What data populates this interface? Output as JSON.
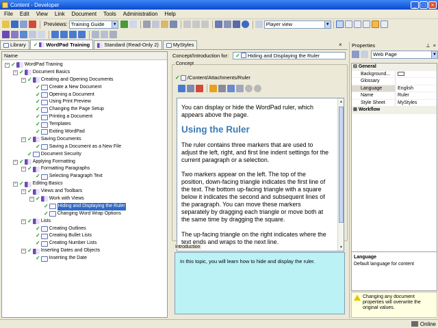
{
  "window": {
    "title": "Content - Developer"
  },
  "menu": [
    "File",
    "Edit",
    "View",
    "Link",
    "Document",
    "Tools",
    "Administration",
    "Help"
  ],
  "toolbar": {
    "previews_label": "Previews:",
    "previews_value": "Training Guide",
    "player_value": "Player view"
  },
  "tabs": [
    {
      "label": "Library",
      "checked": false
    },
    {
      "label": "WordPad Training",
      "checked": true
    },
    {
      "label": "Standard (Read-Only 2)",
      "checked": false
    },
    {
      "label": "MyStyles",
      "checked": false
    }
  ],
  "tree": {
    "header": "Name",
    "items": [
      {
        "label": "WordPad Training",
        "depth": 0,
        "icon": "book",
        "toggle": "-"
      },
      {
        "label": "Document Basics",
        "depth": 1,
        "icon": "book",
        "toggle": "-"
      },
      {
        "label": "Creating and Opening Documents",
        "depth": 2,
        "icon": "book",
        "toggle": "-"
      },
      {
        "label": "Create a New Document",
        "depth": 3,
        "icon": "page",
        "toggle": ""
      },
      {
        "label": "Opening a Document",
        "depth": 3,
        "icon": "page",
        "toggle": ""
      },
      {
        "label": "Using Print Preview",
        "depth": 3,
        "icon": "page",
        "toggle": ""
      },
      {
        "label": "Changing the Page Setup",
        "depth": 3,
        "icon": "page",
        "toggle": ""
      },
      {
        "label": "Printing a Document",
        "depth": 3,
        "icon": "page",
        "toggle": ""
      },
      {
        "label": "Templates",
        "depth": 3,
        "icon": "page",
        "toggle": ""
      },
      {
        "label": "Exiting WordPad",
        "depth": 3,
        "icon": "page",
        "toggle": ""
      },
      {
        "label": "Saving Documents",
        "depth": 2,
        "icon": "book",
        "toggle": "-"
      },
      {
        "label": "Saving a Document as a New File",
        "depth": 3,
        "icon": "page",
        "toggle": ""
      },
      {
        "label": "Document Security",
        "depth": 2,
        "icon": "page",
        "toggle": ""
      },
      {
        "label": "Applying Formatting",
        "depth": 1,
        "icon": "book",
        "toggle": "-"
      },
      {
        "label": "Formatting Paragraphs",
        "depth": 2,
        "icon": "book",
        "toggle": "-"
      },
      {
        "label": "Selecting Paragraph Text",
        "depth": 3,
        "icon": "page",
        "toggle": ""
      },
      {
        "label": "Editing Basics",
        "depth": 1,
        "icon": "book",
        "toggle": "-"
      },
      {
        "label": "Views and Toolbars",
        "depth": 2,
        "icon": "book",
        "toggle": "-"
      },
      {
        "label": "Work with Views",
        "depth": 3,
        "icon": "book",
        "toggle": "-"
      },
      {
        "label": "Hiding and Displaying the Ruler",
        "depth": 4,
        "icon": "page",
        "toggle": "",
        "selected": true
      },
      {
        "label": "Changing Word Wrap Options",
        "depth": 4,
        "icon": "page",
        "toggle": ""
      },
      {
        "label": "Lists",
        "depth": 2,
        "icon": "book",
        "toggle": "-"
      },
      {
        "label": "Creating Outlines",
        "depth": 3,
        "icon": "page",
        "toggle": ""
      },
      {
        "label": "Creating Bullet Lists",
        "depth": 3,
        "icon": "page",
        "toggle": ""
      },
      {
        "label": "Creating Number Lists",
        "depth": 3,
        "icon": "page",
        "toggle": ""
      },
      {
        "label": "Inserting Dates and Objects",
        "depth": 2,
        "icon": "book",
        "toggle": "-"
      },
      {
        "label": "Inserting the Date",
        "depth": 3,
        "icon": "page",
        "toggle": ""
      }
    ]
  },
  "concept": {
    "header_label": "Concept/Introduction for:",
    "header_value": "Hiding and Displaying the Ruler",
    "group_label": "Concept",
    "path": "/Content/Attachments/Ruler",
    "para1": "You can display or hide the WordPad ruler, which appears above the page.",
    "heading": "Using the Ruler",
    "para2": "The ruler contains three markers that are used to adjust the left, right, and first line indent settings for the current paragraph or a selection.",
    "para3": "Two markers appear on the left. The top of the position, down-facing triangle indicates the first line of the text. The bottom up-facing triangle with a square below it indicates the second and subsequent lines of the paragraph. You can move these markers separately by dragging each triangle or move both at the same time by dragging the square.",
    "para4": "The up-facing triangle on the right indicates where the text ends and wraps to the next line."
  },
  "introduction": {
    "group_label": "Introduction",
    "text": "In this topic, you will learn how to hide and display the ruler."
  },
  "properties": {
    "title": "Properties",
    "combo": "Web Page",
    "rows": [
      {
        "name": "General",
        "value": "",
        "category": true
      },
      {
        "name": "Background...",
        "value": "",
        "category": false
      },
      {
        "name": "Glossary",
        "value": "",
        "category": false
      },
      {
        "name": "Language",
        "value": "English",
        "category": false,
        "highlight": true
      },
      {
        "name": "Name",
        "value": "Ruler",
        "category": false
      },
      {
        "name": "Style Sheet",
        "value": "MyStyles",
        "category": false
      },
      {
        "name": "Workflow",
        "value": "",
        "category": true
      }
    ],
    "desc_title": "Language",
    "desc_text": "Default language for content",
    "warning": "Changing any document properties will overwrite the original values."
  },
  "status": {
    "text": "Online"
  },
  "colors": {
    "accent": "#316ac5",
    "intro_bg": "#baf2f6",
    "heading": "#3c7ab4",
    "check": "#1a9a1a"
  }
}
